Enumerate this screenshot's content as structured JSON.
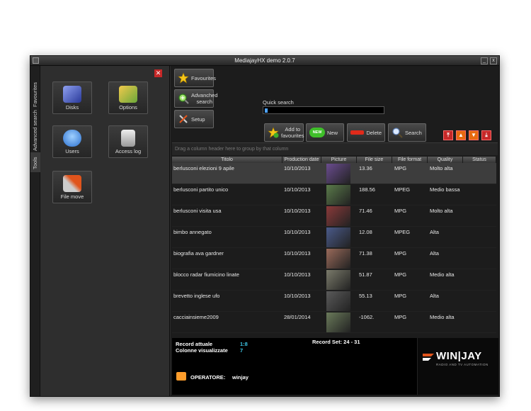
{
  "window": {
    "title": "MediajayHX demo 2.0.7",
    "min_glyph": "_",
    "close_glyph": "x"
  },
  "vtabs": [
    {
      "label": "Favourites"
    },
    {
      "label": "Advanced search"
    },
    {
      "label": "Tools"
    }
  ],
  "tools": [
    {
      "label": "Disks",
      "icon": "book-icon",
      "color": "#4b62c9"
    },
    {
      "label": "Options",
      "icon": "lab-icon",
      "color": "#8fc24a"
    },
    {
      "label": "Users",
      "icon": "users-icon",
      "color": "#3e8ce6"
    },
    {
      "label": "Access log",
      "icon": "document-icon",
      "color": "#bbbbbb"
    },
    {
      "label": "File move",
      "icon": "tools-icon",
      "color": "#d84a1a"
    }
  ],
  "toolbar": {
    "favourites": "Favourites",
    "advanced_search_l1": "Advanched",
    "advanced_search_l2": "search",
    "setup": "Setup",
    "add_fav_l1": "Add to",
    "add_fav_l2": "favourites",
    "new": "New",
    "new_badge": "NEW",
    "delete": "Delete",
    "search": "Search"
  },
  "quick_search": {
    "label": "Quick search",
    "value": ""
  },
  "group_hint": "Drag a column header here to group by that column",
  "columns": [
    "Titolo",
    "Production date",
    "Picture",
    "File size",
    "File format",
    "Quality",
    "Status"
  ],
  "rows": [
    {
      "title": "berlusconi elezioni 9 apile",
      "date": "10/10/2013",
      "size": "13.36",
      "format": "MPG",
      "quality": "Molto alta",
      "status": "",
      "thumb": "#6a4c8f"
    },
    {
      "title": "berlusconi partito unico",
      "date": "10/10/2013",
      "size": "188.56",
      "format": "MPEG",
      "quality": "Medio bassa",
      "status": "",
      "thumb": "#5a7a4a"
    },
    {
      "title": "berlusconi visita usa",
      "date": "10/10/2013",
      "size": "71.46",
      "format": "MPG",
      "quality": "Molto alta",
      "status": "",
      "thumb": "#8a3a3a"
    },
    {
      "title": "bimbo annegato",
      "date": "10/10/2013",
      "size": "12.08",
      "format": "MPEG",
      "quality": "Alta",
      "status": "",
      "thumb": "#4a5a8a"
    },
    {
      "title": "biografia ava gardner",
      "date": "10/10/2013",
      "size": "71.38",
      "format": "MPG",
      "quality": "Alta",
      "status": "",
      "thumb": "#9a6a5a"
    },
    {
      "title": "blocco radar fiumicino linate",
      "date": "10/10/2013",
      "size": "51.87",
      "format": "MPG",
      "quality": "Medio alta",
      "status": "",
      "thumb": "#7a7a6a"
    },
    {
      "title": "brevetto inglese ufo",
      "date": "10/10/2013",
      "size": "55.13",
      "format": "MPG",
      "quality": "Alta",
      "status": "",
      "thumb": "#5a5a5a"
    },
    {
      "title": "cacciainsieme2009",
      "date": "28/01/2014",
      "size": "-1062.",
      "format": "MPG",
      "quality": "Medio alta",
      "status": "",
      "thumb": "#6a7a5a"
    }
  ],
  "footer": {
    "record_label": "Record attuale",
    "record_value": "1:8",
    "columns_label": "Colonne visualizzate",
    "columns_value": "7",
    "recordset": "Record Set: 24 - 31",
    "operator_label": "OPERATORE:",
    "operator_value": "winjay"
  },
  "brand": {
    "name": "WIN|JAY",
    "tagline": "RADIO AND TV AUTOMATION"
  }
}
